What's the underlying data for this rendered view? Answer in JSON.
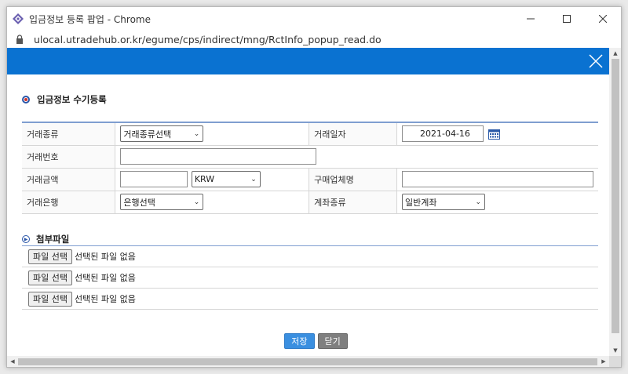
{
  "window": {
    "title": "입금정보 등록 팝업 - Chrome",
    "url": "ulocal.utradehub.or.kr/egume/cps/indirect/mng/RctInfo_popup_read.do"
  },
  "section_title": "입금정보 수기등록",
  "form": {
    "trade_type_label": "거래종류",
    "trade_type_value": "거래종류선택",
    "trade_date_label": "거래일자",
    "trade_date_value": "2021-04-16",
    "trade_no_label": "거래번호",
    "trade_no_value": "",
    "amount_label": "거래금액",
    "amount_value": "",
    "currency_value": "KRW",
    "buyer_label": "구매업체명",
    "buyer_value": "",
    "bank_label": "거래은행",
    "bank_value": "은행선택",
    "account_type_label": "계좌종류",
    "account_type_value": "일반계좌"
  },
  "attachments": {
    "title": "첨부파일",
    "items": [
      {
        "button": "파일 선택",
        "status": "선택된 파일 없음"
      },
      {
        "button": "파일 선택",
        "status": "선택된 파일 없음"
      },
      {
        "button": "파일 선택",
        "status": "선택된 파일 없음"
      }
    ]
  },
  "buttons": {
    "save": "저장",
    "close": "닫기"
  },
  "colors": {
    "header_blue": "#0a72d1",
    "save_blue": "#3a8fe0",
    "close_gray": "#7f7f7f"
  }
}
